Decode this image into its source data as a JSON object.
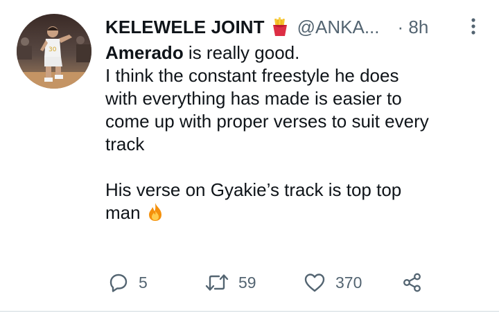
{
  "tweet": {
    "display_name": "KELEWELE JOINT",
    "handle": "@ANKA...",
    "time": "· 8h",
    "avatar_icon": "basketball-player-avatar",
    "name_emoji_icon": "french-fries-emoji",
    "body": {
      "mention": "Amerado",
      "line1_rest": " is really good.",
      "line2": "I think the constant freestyle he does",
      "line3": "with everything has made is easier to",
      "line4": "come up with proper verses to suit every",
      "line5": "track",
      "line6": "His verse on Gyakie’s track is top top",
      "line7": "man",
      "end_emoji_icon": "fire-emoji"
    },
    "actions": {
      "reply_count": "5",
      "retweet_count": "59",
      "like_count": "370"
    }
  },
  "colors": {
    "text": "#0f1419",
    "secondary": "#536471",
    "divider": "#cfd9de"
  }
}
